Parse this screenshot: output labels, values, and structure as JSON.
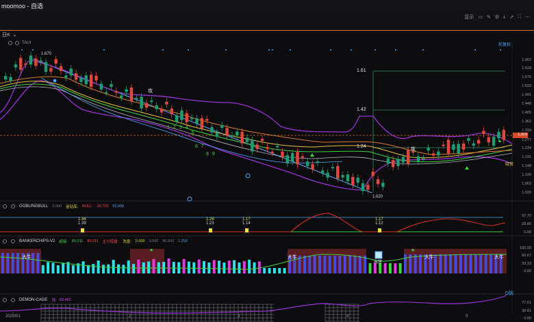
{
  "app": {
    "title": "moomoo - 自选"
  },
  "toolbar": {
    "display_label": "显示",
    "icons": [
      "layout-icon",
      "pencil-icon",
      "gear-icon",
      "download-icon",
      "share-icon",
      "fullscreen-icon",
      "more-icon"
    ]
  },
  "period": {
    "label": "日K"
  },
  "main_indicator": {
    "name": "TAUI"
  },
  "restore_label": "前复权",
  "price_axis": [
    "1.662",
    "1.619",
    "1.576",
    "1.533",
    "1.491",
    "1.448",
    "1.405",
    "1.362",
    "1.319",
    "1.277",
    "1.234",
    "1.191",
    "1.148",
    "1.106",
    "1.063",
    "1.020"
  ],
  "current_price": "1.319",
  "annotations": {
    "high": "1.670",
    "low": "1.020",
    "fib1": "1.61",
    "fib2": "1.42",
    "fib3": "1.24",
    "attack1": "攻",
    "attack2": "攻",
    "buy_label": "吸货",
    "seq1": [
      "1",
      "2",
      "3",
      "4",
      "5"
    ],
    "seq2": [
      "6",
      "7"
    ],
    "seq3": [
      "8",
      "9"
    ]
  },
  "goblin": {
    "name": "GOBLINGBULL",
    "v1": "0.000",
    "label1": "金钻底:",
    "label2": "BULL:",
    "v2": "33.720",
    "v3": "55.000",
    "axis": [
      "57.70",
      "28.85",
      "0.00"
    ],
    "signals": [
      {
        "top": "1.44",
        "bottom": "1.39"
      },
      {
        "top": "1.26",
        "bottom": "1.23"
      },
      {
        "top": "1.17",
        "bottom": "1.14"
      },
      {
        "top": "1.17",
        "bottom": "1.12"
      }
    ]
  },
  "banker": {
    "name": "BANKERCHIPS-V2",
    "label1": "超级:",
    "v1": "85.011",
    "v2": "85.011",
    "label2": "主力控盘:",
    "label3": "洗盘:",
    "v3": "0.000",
    "v4": "0.000",
    "v5": "90.000",
    "v6": "1.250",
    "axis": [
      "100.00",
      "66.67",
      "33.33",
      "0.00"
    ],
    "bull_tags": [
      "大牛",
      "大牛",
      "大牛",
      "大牛"
    ],
    "sell_tag": "出货"
  },
  "demon": {
    "name": "DEMON-CAGE",
    "label": "顶",
    "v1": "69.402",
    "axis": [
      "77.61",
      "38.81",
      "0.00"
    ],
    "tag": "D妖"
  },
  "x_axis": [
    "2025/01",
    "2",
    "3",
    "4",
    "5"
  ],
  "colors": {
    "up": "#1f9d72",
    "down": "#e0483c",
    "accent": "#d86a1a",
    "purple": "#a23cd8",
    "blue": "#4aa8ff"
  }
}
